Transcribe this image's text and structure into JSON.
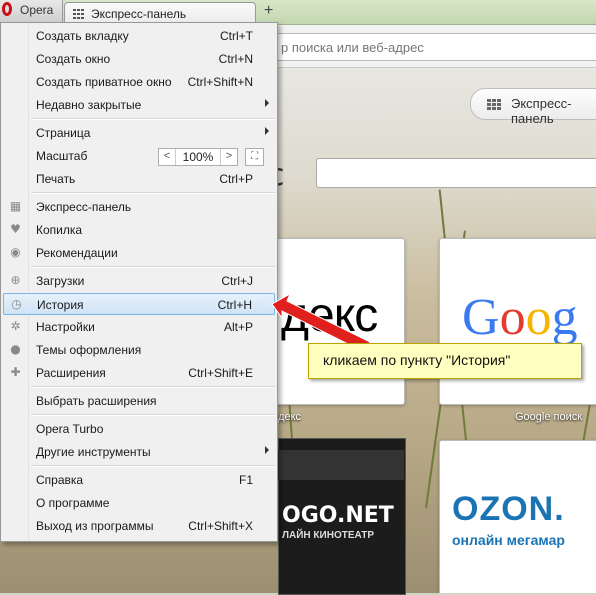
{
  "browser": {
    "app_button": "Opera",
    "tab_title": "Экспресс-панель",
    "new_tab": "+",
    "address_placeholder": "р поиска или веб-адрес"
  },
  "page": {
    "express_panel_button": "Экспресс-панель",
    "search_prefix": "с",
    "tiles": [
      {
        "name": "yandex",
        "logo": "декс",
        "caption": "ндекс"
      },
      {
        "name": "google",
        "logo": [
          "G",
          "o",
          "o",
          "g"
        ],
        "caption": "Google поиск"
      },
      {
        "name": "kino",
        "logo": "OGO.NET",
        "sub": "ЛАЙН КИНОТЕАТР"
      },
      {
        "name": "ozon",
        "logo": "OZON.",
        "sub": "онлайн мегамар"
      }
    ],
    "google_colors": [
      "#3a7af0",
      "#e33b2e",
      "#f4b400",
      "#3a7af0"
    ]
  },
  "menu": {
    "items": [
      {
        "label": "Создать вкладку",
        "shortcut": "Ctrl+T"
      },
      {
        "label": "Создать окно",
        "shortcut": "Ctrl+N"
      },
      {
        "label": "Создать приватное окно",
        "shortcut": "Ctrl+Shift+N"
      },
      {
        "label": "Недавно закрытые",
        "shortcut": ""
      },
      {
        "label": "Страница",
        "shortcut": ""
      },
      {
        "label": "Масштаб",
        "shortcut": ""
      },
      {
        "label": "Печать",
        "shortcut": "Ctrl+P"
      },
      {
        "label": "Экспресс-панель",
        "shortcut": "",
        "icon": "grid-icon"
      },
      {
        "label": "Копилка",
        "shortcut": "",
        "icon": "heart-icon"
      },
      {
        "label": "Рекомендации",
        "shortcut": "",
        "icon": "eye-icon"
      },
      {
        "label": "Загрузки",
        "shortcut": "Ctrl+J",
        "icon": "download-icon"
      },
      {
        "label": "История",
        "shortcut": "Ctrl+H",
        "icon": "clock-icon"
      },
      {
        "label": "Настройки",
        "shortcut": "Alt+P",
        "icon": "gear-icon"
      },
      {
        "label": "Темы оформления",
        "shortcut": "",
        "icon": "drop-icon"
      },
      {
        "label": "Расширения",
        "shortcut": "Ctrl+Shift+E",
        "icon": "puzzle-icon"
      },
      {
        "label": "Выбрать расширения",
        "shortcut": ""
      },
      {
        "label": "Opera Turbo",
        "shortcut": ""
      },
      {
        "label": "Другие инструменты",
        "shortcut": ""
      },
      {
        "label": "Справка",
        "shortcut": "F1"
      },
      {
        "label": "О программе",
        "shortcut": ""
      },
      {
        "label": "Выход из программы",
        "shortcut": "Ctrl+Shift+X"
      }
    ],
    "zoom": {
      "decrease": "<",
      "value": "100%",
      "increase": ">",
      "fullscreen": "⛶"
    }
  },
  "annotation": {
    "callout": "кликаем по пункту \"История\"",
    "color": "#e0201c"
  }
}
